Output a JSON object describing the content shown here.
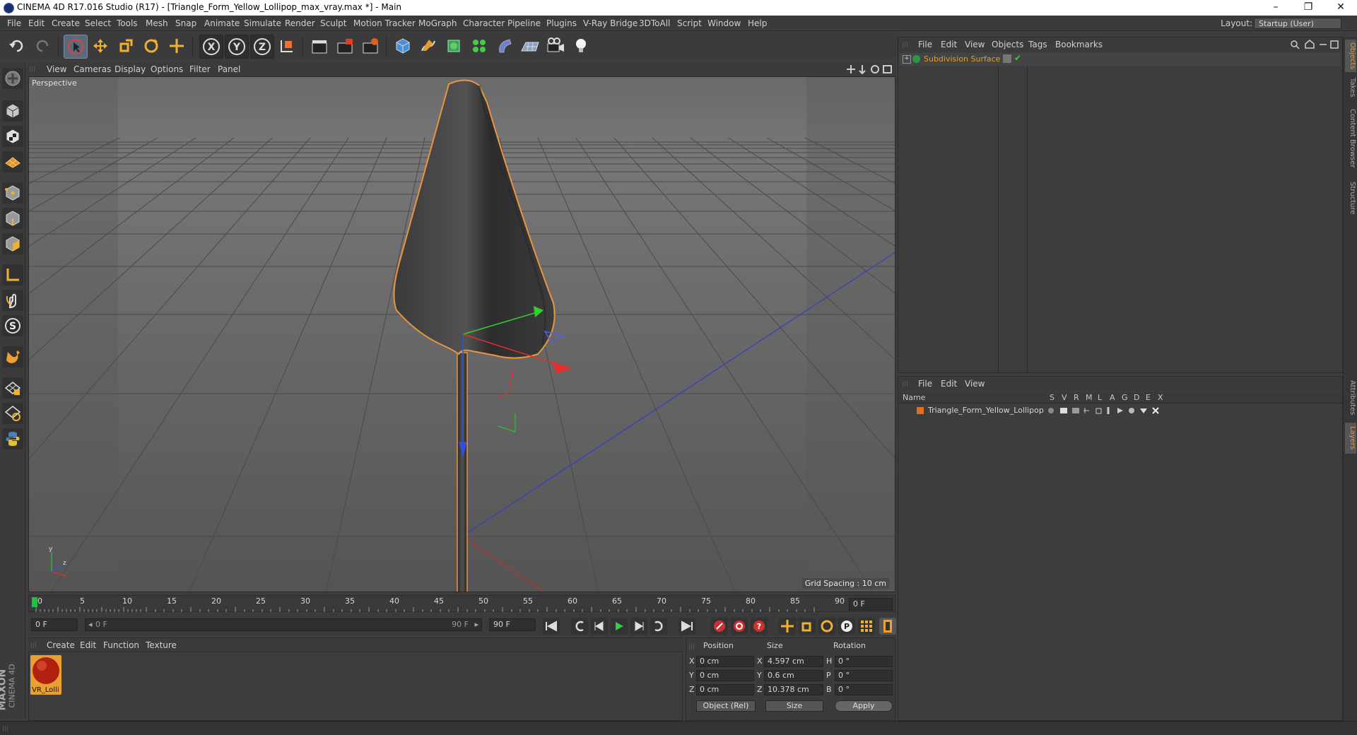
{
  "window": {
    "title": "CINEMA 4D R17.016 Studio (R17) - [Triangle_Form_Yellow_Lollipop_max_vray.max *] - Main",
    "controls": {
      "minimize": "–",
      "restore": "❐",
      "close": "✕"
    }
  },
  "menu": [
    "File",
    "Edit",
    "Create",
    "Select",
    "Tools",
    "Mesh",
    "Snap",
    "Animate",
    "Simulate",
    "Render",
    "Sculpt",
    "Motion Tracker",
    "MoGraph",
    "Character",
    "Pipeline",
    "Plugins",
    "V-Ray Bridge",
    "3DToAll",
    "Script",
    "Window",
    "Help"
  ],
  "layout": {
    "label": "Layout:",
    "value": "Startup (User)"
  },
  "toolbar": {
    "axis_x": "X",
    "axis_y": "Y",
    "axis_z": "Z"
  },
  "left_tools": {
    "sculpt_letter": "S"
  },
  "viewport": {
    "menu": [
      "View",
      "Cameras",
      "Display",
      "Options",
      "Filter",
      "Panel"
    ],
    "label": "Perspective",
    "grid_spacing": "Grid Spacing : 10 cm",
    "axis_y": "y",
    "axis_z": "z"
  },
  "timeline": {
    "ticks": [
      "0",
      "5",
      "10",
      "15",
      "20",
      "25",
      "30",
      "35",
      "40",
      "45",
      "50",
      "55",
      "60",
      "65",
      "70",
      "75",
      "80",
      "85",
      "90"
    ],
    "end_frame": "0 F"
  },
  "transport": {
    "start": "0 F",
    "range_start": "0 F",
    "range_end": "90 F",
    "end": "90 F",
    "key_p": "P"
  },
  "materials": {
    "menu": [
      "Create",
      "Edit",
      "Function",
      "Texture"
    ],
    "item_label": "VR_Lolli",
    "brand_top": "MAXON",
    "brand_bottom": "CINEMA 4D"
  },
  "coords": {
    "headers": [
      "Position",
      "Size",
      "Rotation"
    ],
    "rows": [
      {
        "axis": "X",
        "pos": "0 cm",
        "size_axis": "X",
        "size": "4.597 cm",
        "rot_axis": "H",
        "rot": "0 °"
      },
      {
        "axis": "Y",
        "pos": "0 cm",
        "size_axis": "Y",
        "size": "0.6 cm",
        "rot_axis": "P",
        "rot": "0 °"
      },
      {
        "axis": "Z",
        "pos": "0 cm",
        "size_axis": "Z",
        "size": "10.378 cm",
        "rot_axis": "B",
        "rot": "0 °"
      }
    ],
    "mode": "Object (Rel)",
    "size_mode": "Size",
    "apply": "Apply"
  },
  "objects": {
    "menu": [
      "File",
      "Edit",
      "View",
      "Objects",
      "Tags",
      "Bookmarks"
    ],
    "item": "Subdivision Surface",
    "item_color": "#e0a020"
  },
  "layers": {
    "menu": [
      "File",
      "Edit",
      "View"
    ],
    "columns": [
      "Name",
      "S",
      "V",
      "R",
      "M",
      "L",
      "A",
      "G",
      "D",
      "E",
      "X"
    ],
    "item": "Triangle_Form_Yellow_Lollipop",
    "item_color": "#e07020"
  },
  "right_tabs": [
    "Objects",
    "Takes",
    "Content Browser",
    "Structure",
    "Attributes",
    "Layers"
  ],
  "colors": {
    "accent": "#5b7fb0",
    "selection": "#e8963c",
    "x_axis": "#e03030",
    "y_axis": "#30c030",
    "z_axis": "#3050e0"
  }
}
